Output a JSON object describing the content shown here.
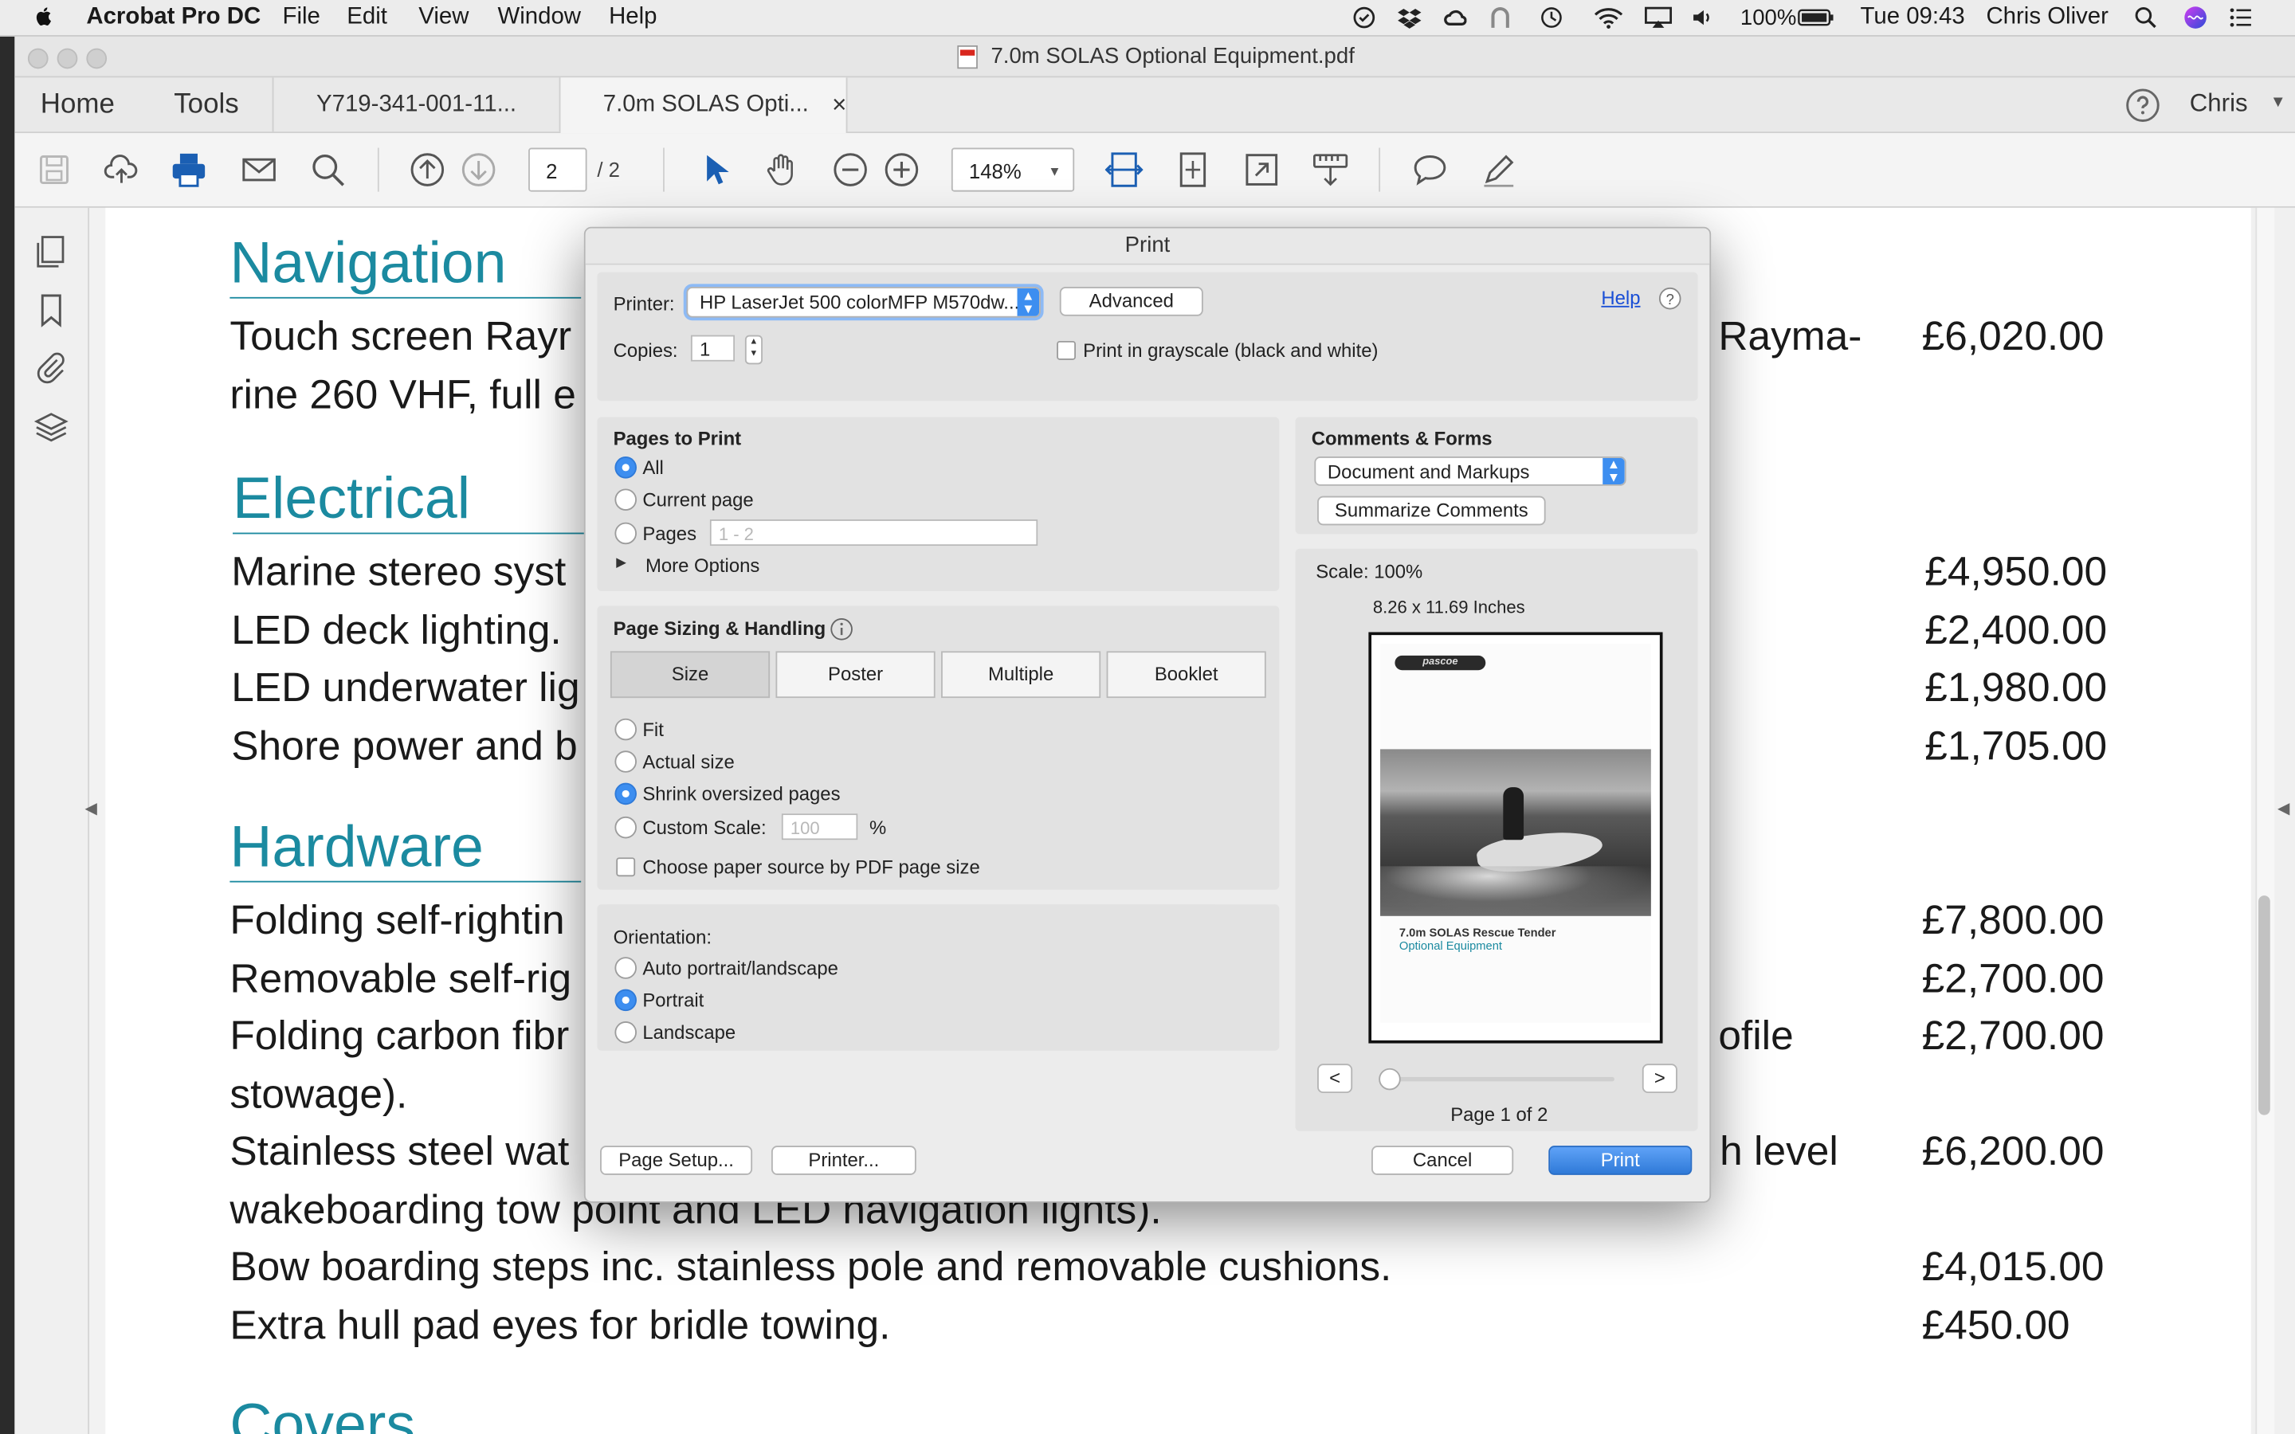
{
  "menubar": {
    "app_name": "Acrobat Pro DC",
    "menus": [
      "File",
      "Edit",
      "View",
      "Window",
      "Help"
    ],
    "battery": "100%",
    "clock": "Tue 09:43",
    "user": "Chris Oliver"
  },
  "window": {
    "title": "7.0m SOLAS Optional Equipment.pdf"
  },
  "tabs": {
    "home": "Home",
    "tools": "Tools",
    "doc1": "Y719-341-001-11...",
    "doc2": "7.0m SOLAS Opti...",
    "close": "×",
    "account": "Chris"
  },
  "toolbar": {
    "page_current": "2",
    "page_total": "/ 2",
    "zoom": "148%"
  },
  "document": {
    "sections": {
      "navigation": "Navigation",
      "electrical": "Electrical",
      "hardware": "Hardware",
      "covers": "Covers"
    },
    "lines": {
      "nav1": "Touch screen Rayr",
      "nav1_right": "Rayma-",
      "nav2": "rine 260 VHF, full e",
      "el1": "Marine stereo syst",
      "el2": "LED deck lighting.",
      "el3": "LED underwater lig",
      "el4": "Shore power and b",
      "hw1": "Folding self-rightin",
      "hw2": "Removable self-rig",
      "hw3": "Folding carbon fibr",
      "hw3_right": "ofile",
      "hw4": "stowage).",
      "hw5": "Stainless steel wat",
      "hw5_right": "h level",
      "hw6": "wakeboarding tow point and LED navigation lights).",
      "hw7": "Bow boarding steps inc. stainless pole and removable cushions.",
      "hw8": "Extra hull pad eyes for bridle towing."
    },
    "prices": {
      "nav": "£6,020.00",
      "el1": "£4,950.00",
      "el2": "£2,400.00",
      "el3": "£1,980.00",
      "el4": "£1,705.00",
      "hw1": "£7,800.00",
      "hw2": "£2,700.00",
      "hw3": "£2,700.00",
      "hw5": "£6,200.00",
      "hw7": "£4,015.00",
      "hw8": "£450.00"
    }
  },
  "print_dialog": {
    "title": "Print",
    "printer_label": "Printer:",
    "printer_value": "HP LaserJet 500 colorMFP M570dw...",
    "advanced": "Advanced",
    "help": "Help",
    "copies_label": "Copies:",
    "copies_value": "1",
    "grayscale": "Print in grayscale (black and white)",
    "pages_to_print": {
      "heading": "Pages to Print",
      "all": "All",
      "current": "Current page",
      "pages": "Pages",
      "pages_placeholder": "1 - 2",
      "more": "More Options",
      "selected": "All"
    },
    "sizing": {
      "heading": "Page Sizing & Handling",
      "tabs": [
        "Size",
        "Poster",
        "Multiple",
        "Booklet"
      ],
      "active_tab": "Size",
      "fit": "Fit",
      "actual": "Actual size",
      "shrink": "Shrink oversized pages",
      "custom": "Custom Scale:",
      "custom_placeholder": "100",
      "percent": "%",
      "paper_source": "Choose paper source by PDF page size",
      "selected": "Shrink oversized pages"
    },
    "orientation": {
      "heading": "Orientation:",
      "auto": "Auto portrait/landscape",
      "portrait": "Portrait",
      "landscape": "Landscape",
      "selected": "Portrait"
    },
    "comments": {
      "heading": "Comments & Forms",
      "value": "Document and Markups",
      "summarize": "Summarize Comments"
    },
    "preview": {
      "scale": "Scale: 100%",
      "size": "8.26 x 11.69 Inches",
      "logo": "pascoe",
      "doc_title": "7.0m SOLAS Rescue Tender",
      "doc_subtitle": "Optional Equipment",
      "prev": "<",
      "next": ">",
      "page": "Page 1 of 2"
    },
    "buttons": {
      "page_setup": "Page Setup...",
      "printer": "Printer...",
      "cancel": "Cancel",
      "print": "Print"
    }
  },
  "colors": {
    "accent": "#3d8ef0",
    "heading_teal": "#1b8aa0",
    "print_blue": "#2f7ad8"
  }
}
